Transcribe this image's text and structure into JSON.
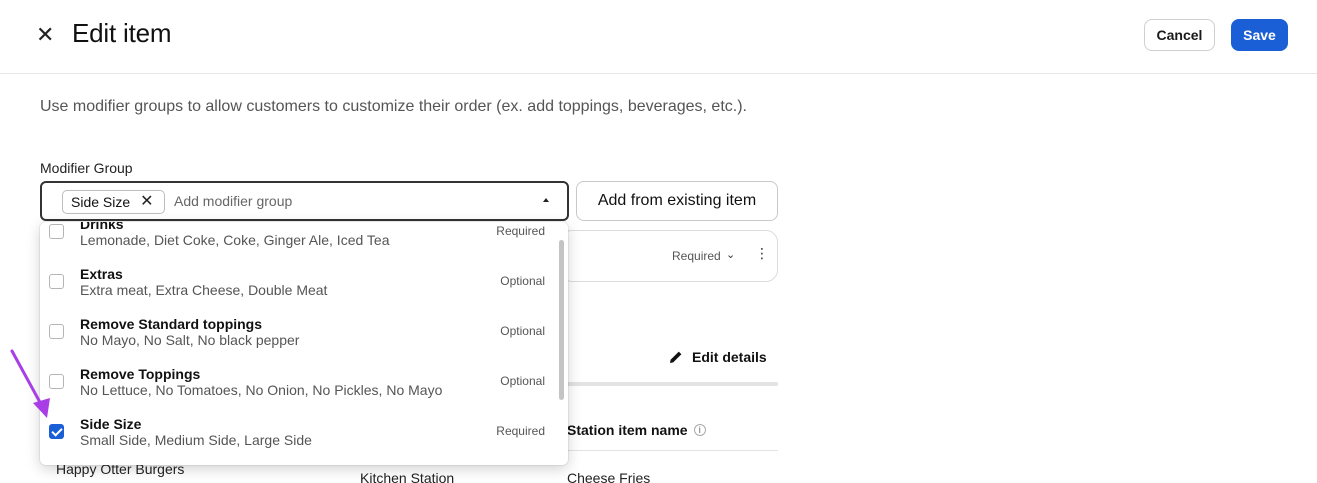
{
  "header": {
    "title": "Edit item",
    "cancel_label": "Cancel",
    "save_label": "Save"
  },
  "intro_text": "Use modifier groups to allow customers to customize their order (ex. add toppings, beverages, etc.).",
  "modifier_field": {
    "label": "Modifier Group",
    "selected_chip": "Side Size",
    "placeholder": "Add modifier group"
  },
  "add_existing_label": "Add from existing item",
  "background": {
    "card_badge": "Required",
    "edit_details_label": "Edit details",
    "col_station_item_name": "Station item name",
    "row": {
      "restaurant": "Happy Otter Burgers",
      "station": "Kitchen Station",
      "item": "Cheese Fries"
    }
  },
  "dropdown_options": [
    {
      "name": "Drinks",
      "sub": "Lemonade, Diet Coke, Coke, Ginger Ale, Iced Tea",
      "badge": "Required",
      "checked": false
    },
    {
      "name": "Extras",
      "sub": "Extra meat, Extra Cheese, Double Meat",
      "badge": "Optional",
      "checked": false
    },
    {
      "name": "Remove Standard toppings",
      "sub": "No Mayo, No Salt, No black pepper",
      "badge": "Optional",
      "checked": false
    },
    {
      "name": "Remove Toppings",
      "sub": "No Lettuce, No Tomatoes, No Onion, No Pickles, No Mayo",
      "badge": "Optional",
      "checked": false
    },
    {
      "name": "Side Size",
      "sub": "Small Side, Medium Side, Large Side",
      "badge": "Required",
      "checked": true
    }
  ],
  "colors": {
    "primary": "#1a5fd6",
    "annotation_arrow": "#a93ee6"
  }
}
